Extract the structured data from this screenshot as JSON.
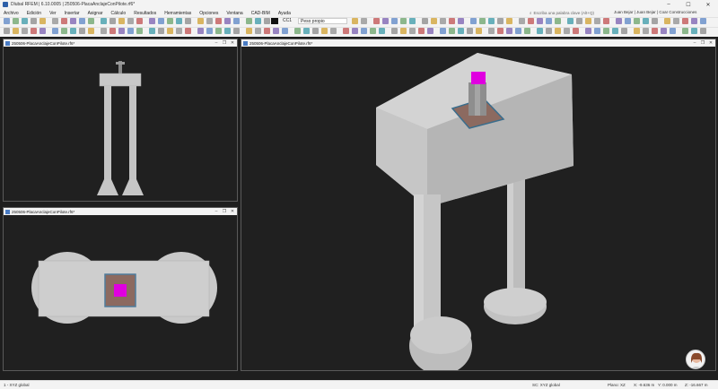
{
  "window": {
    "title": "Dlubal RFEM | 6.10.0005 | 250506-PlacaAnclajeConPilote.rf6*"
  },
  "menu": {
    "items": [
      "Archivo",
      "Edición",
      "Ver",
      "Insertar",
      "Asignar",
      "Cálculo",
      "Resultados",
      "Herramientas",
      "Opciones",
      "Ventana",
      "CAD-BIM",
      "Ayuda"
    ],
    "search_placeholder": "Escriba una palabra clave (Alt+Q)",
    "user": "Juan Bejar | Juan Bejar | Coar Construcciones"
  },
  "toolbar": {
    "load_case_code": "CC1",
    "load_case_name": "Peso propio"
  },
  "views": {
    "top_left_title": "250506-PlacaAnclajeConPilote.rf6*",
    "bottom_left_title": "250506-PlacaAnclajeConPilote.rf6*",
    "right_title": "250506-PlacaAnclajeConPilote.rf6*"
  },
  "status": {
    "left_view": "1 - XYZ global",
    "coord_system": "SC: XYZ global",
    "plane": "Plano: XZ",
    "x": "X: -9.636 m",
    "y": "Y: 0.000 m",
    "z": "Z: -16.667 m"
  },
  "colors": {
    "accent_magenta": "#e000e0",
    "accent_steel": "#3a6d8c",
    "viewport_bg": "#202020"
  }
}
